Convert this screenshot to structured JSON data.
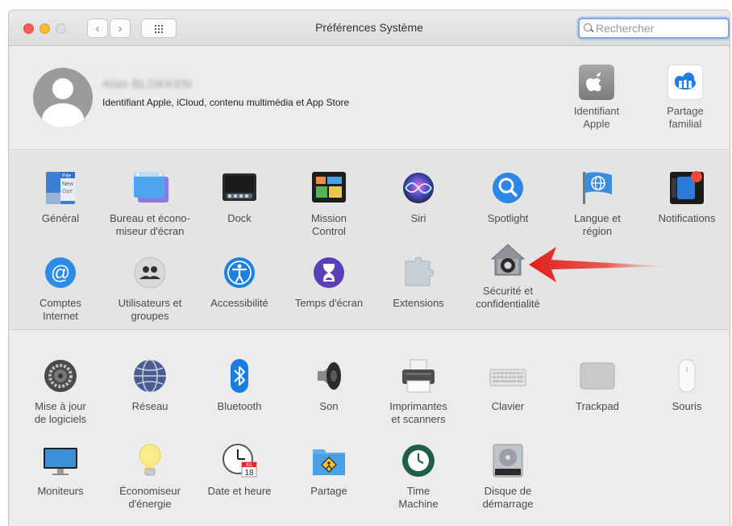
{
  "window": {
    "title": "Préférences Système",
    "search_placeholder": "Rechercher"
  },
  "account": {
    "user_name": "Alan BLOKKEN",
    "subtitle": "Identifiant Apple, iCloud, contenu multimédia et App Store",
    "items": [
      {
        "label": "Identifiant\nApple",
        "icon": "apple-id-icon"
      },
      {
        "label": "Partage\nfamilial",
        "icon": "family-sharing-icon"
      }
    ]
  },
  "panes_row1": [
    {
      "label": "Général",
      "icon": "general-icon"
    },
    {
      "label": "Bureau et écono-\nmiseur d'écran",
      "icon": "desktop-screensaver-icon"
    },
    {
      "label": "Dock",
      "icon": "dock-icon"
    },
    {
      "label": "Mission\nControl",
      "icon": "mission-control-icon"
    },
    {
      "label": "Siri",
      "icon": "siri-icon"
    },
    {
      "label": "Spotlight",
      "icon": "spotlight-icon"
    },
    {
      "label": "Langue et\nrégion",
      "icon": "language-region-icon"
    },
    {
      "label": "Notifications",
      "icon": "notifications-icon"
    }
  ],
  "panes_row2": [
    {
      "label": "Comptes\nInternet",
      "icon": "internet-accounts-icon"
    },
    {
      "label": "Utilisateurs et\ngroupes",
      "icon": "users-groups-icon"
    },
    {
      "label": "Accessibilité",
      "icon": "accessibility-icon"
    },
    {
      "label": "Temps d'écran",
      "icon": "screen-time-icon"
    },
    {
      "label": "Extensions",
      "icon": "extensions-icon"
    },
    {
      "label": "Sécurité et\nconfidentialité",
      "icon": "security-privacy-icon"
    }
  ],
  "panes_row3": [
    {
      "label": "Mise à jour\nde logiciels",
      "icon": "software-update-icon"
    },
    {
      "label": "Réseau",
      "icon": "network-icon"
    },
    {
      "label": "Bluetooth",
      "icon": "bluetooth-icon"
    },
    {
      "label": "Son",
      "icon": "sound-icon"
    },
    {
      "label": "Imprimantes\net scanners",
      "icon": "printers-scanners-icon"
    },
    {
      "label": "Clavier",
      "icon": "keyboard-icon"
    },
    {
      "label": "Trackpad",
      "icon": "trackpad-icon"
    },
    {
      "label": "Souris",
      "icon": "mouse-icon"
    }
  ],
  "panes_row4": [
    {
      "label": "Moniteurs",
      "icon": "displays-icon"
    },
    {
      "label": "Économiseur\nd'énergie",
      "icon": "energy-saver-icon"
    },
    {
      "label": "Date et heure",
      "icon": "date-time-icon",
      "calendar_month": "JUL",
      "calendar_day": "18"
    },
    {
      "label": "Partage",
      "icon": "sharing-icon"
    },
    {
      "label": "Time\nMachine",
      "icon": "time-machine-icon"
    },
    {
      "label": "Disque de\ndémarrage",
      "icon": "startup-disk-icon"
    }
  ],
  "annotation": {
    "icon": "red-arrow-icon",
    "color": "#e0201c"
  }
}
